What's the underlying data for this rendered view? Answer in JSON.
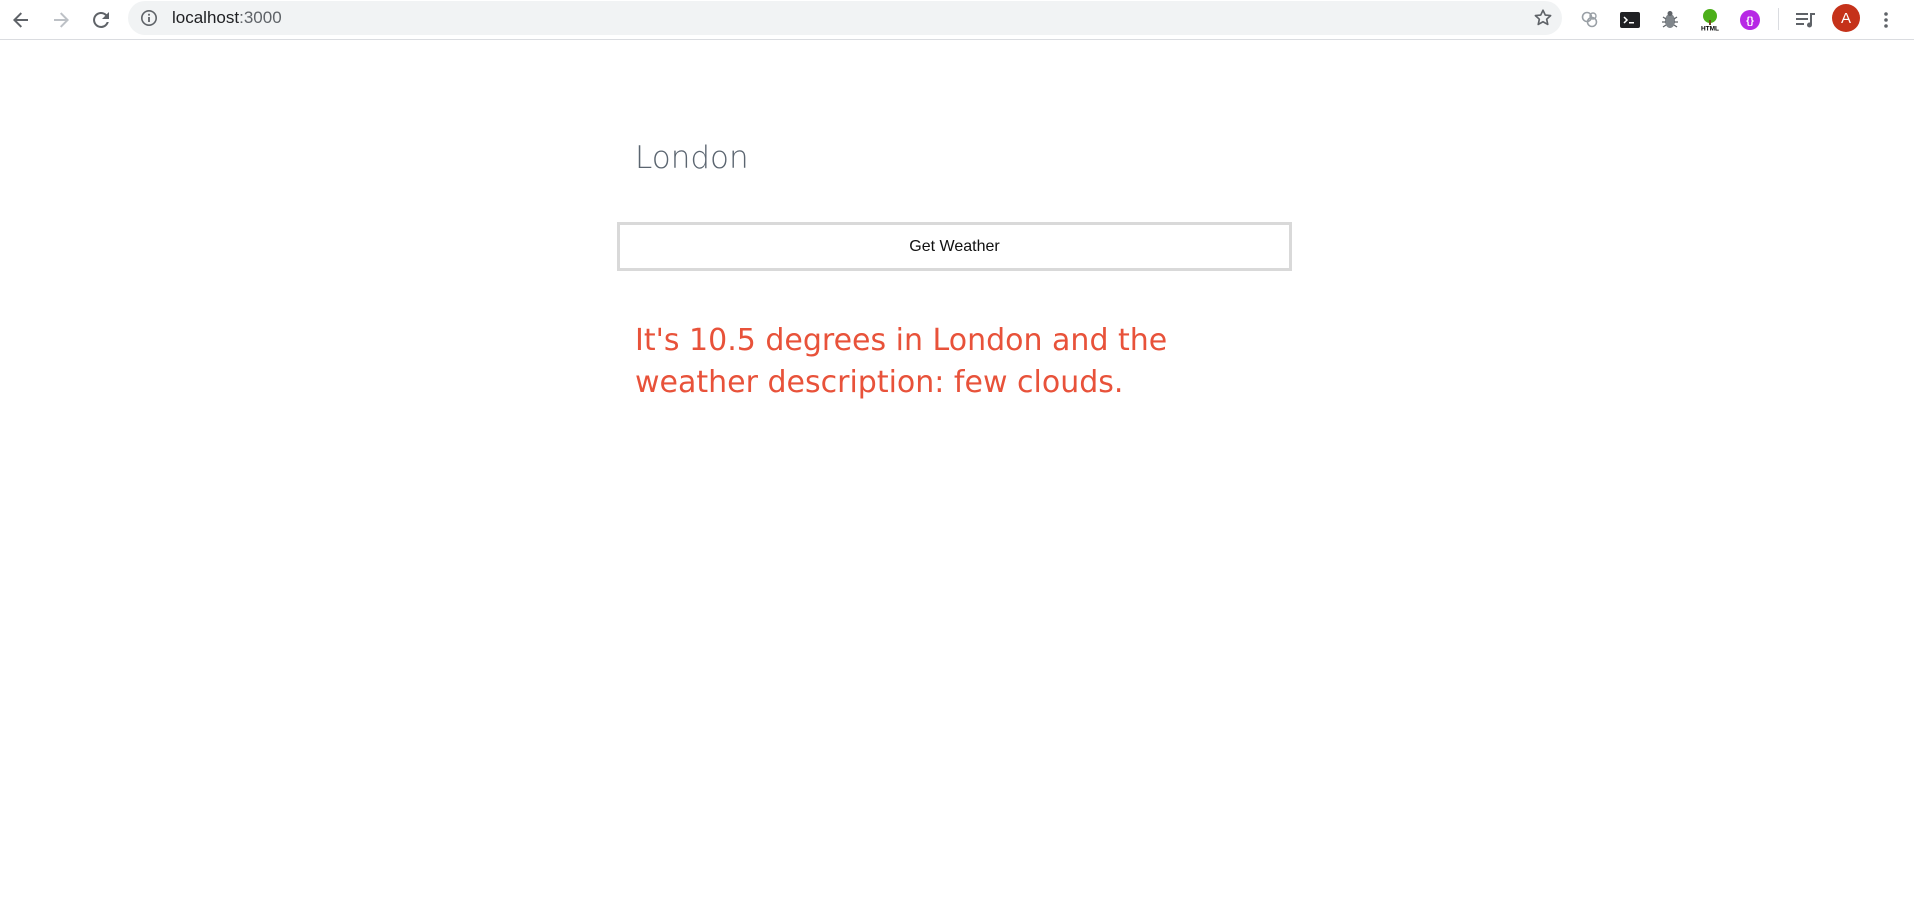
{
  "browser": {
    "url_host": "localhost",
    "url_port": ":3000",
    "profile_initial": "A",
    "extensions": [
      "extension-icon-1",
      "terminal-icon",
      "bug-icon",
      "html-tree-icon",
      "purple-extension-icon"
    ]
  },
  "weather_form": {
    "city_value": "London",
    "button_label": "Get Weather"
  },
  "result": {
    "text": "It's 10.5 degrees in London and the weather description: few clouds."
  },
  "colors": {
    "result_text": "#e8523a",
    "input_text": "#5b6570",
    "avatar": "#c5321a"
  }
}
